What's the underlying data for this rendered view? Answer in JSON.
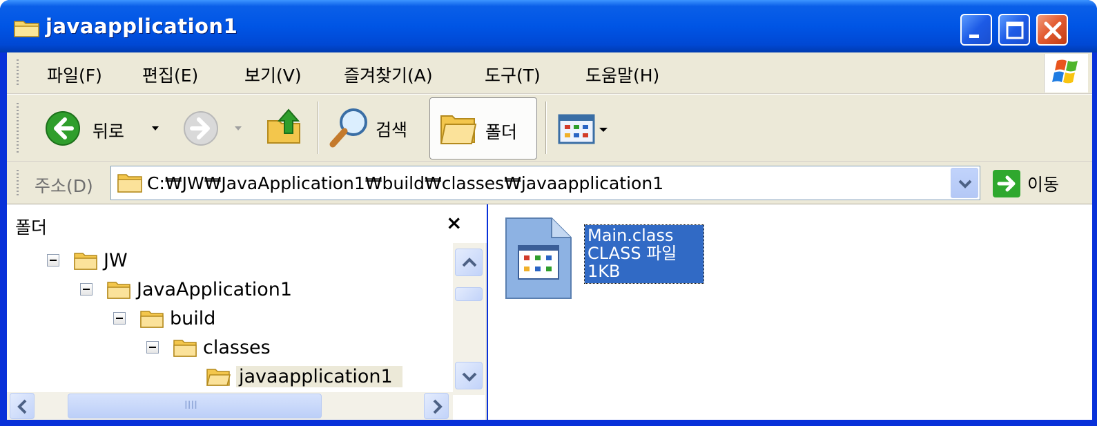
{
  "window": {
    "title": "javaapplication1"
  },
  "menubar": {
    "items": [
      {
        "label": "파일(F)"
      },
      {
        "label": "편집(E)"
      },
      {
        "label": "보기(V)"
      },
      {
        "label": "즐겨찾기(A)"
      },
      {
        "label": "도구(T)"
      },
      {
        "label": "도움말(H)"
      }
    ]
  },
  "toolbar": {
    "back_label": "뒤로",
    "search_label": "검색",
    "folders_label": "폴더"
  },
  "addressbar": {
    "label": "주소(D)",
    "value": "C:₩JW₩JavaApplication1₩build₩classes₩javaapplication1",
    "go_label": "이동"
  },
  "folder_pane": {
    "title": "폴더",
    "close_symbol": "×",
    "tree": [
      {
        "label": "JW"
      },
      {
        "label": "JavaApplication1"
      },
      {
        "label": "build"
      },
      {
        "label": "classes"
      },
      {
        "label": "javaapplication1"
      }
    ],
    "hscroll_thumb_text": "IIII"
  },
  "files": [
    {
      "name": "Main.class",
      "type": "CLASS 파일",
      "size": "1KB"
    }
  ],
  "colors": {
    "titlebar": "#0055e5",
    "chrome": "#ece9d8",
    "selection": "#316ac5",
    "close_button": "#e35d33"
  }
}
